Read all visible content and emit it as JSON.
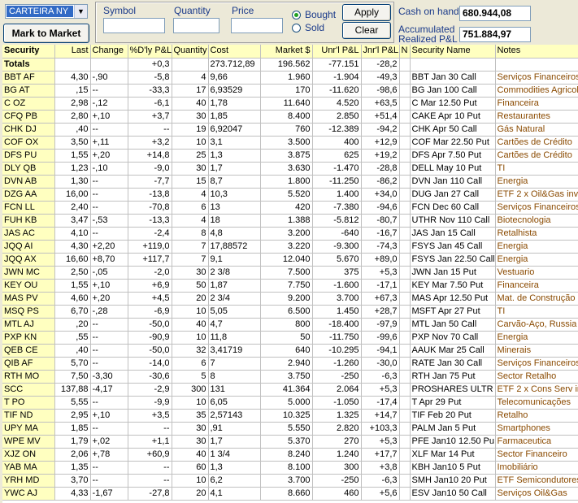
{
  "toolbar": {
    "account": "CARTEIRA NY",
    "mark_to_market": "Mark to Market",
    "symbol_label": "Symbol",
    "quantity_label": "Quantity",
    "price_label": "Price",
    "symbol_value": "",
    "quantity_value": "",
    "price_value": "",
    "bought_label": "Bought",
    "sold_label": "Sold",
    "selected_side": "Bought",
    "apply": "Apply",
    "clear": "Clear",
    "cash_label": "Cash on hand",
    "cash_value": "680.944,08",
    "realized_label_1": "Accumulated",
    "realized_label_2": "Realized P&L",
    "realized_value": "751.884,97"
  },
  "columns": [
    "Security",
    "Last",
    "Change",
    "%D'ly P&L",
    "Quantity",
    "Cost",
    "Market $",
    "Unr'l P&L",
    "Jnr'l P&L",
    "N",
    "Security Name",
    "Notes"
  ],
  "totals": [
    "Totals",
    "",
    "",
    "+0,3",
    "",
    "273.712,89",
    "196.562",
    "-77.151",
    "-28,2",
    "",
    "",
    ""
  ],
  "rows": [
    [
      "BBT AF",
      "4,30",
      "-,90",
      "-5,8",
      "4",
      "9,66",
      "1.960",
      "-1.904",
      "-49,3",
      "",
      "BBT Jan 30 Call",
      "Serviços Financeiros"
    ],
    [
      "BG AT",
      ",15",
      "--",
      "-33,3",
      "17",
      "6,93529",
      "170",
      "-11.620",
      "-98,6",
      "",
      "BG Jan 100 Call",
      "Commodities Agricolas"
    ],
    [
      "C OZ",
      "2,98",
      "-,12",
      "-6,1",
      "40",
      "1,78",
      "11.640",
      "4.520",
      "+63,5",
      "",
      "C Mar 12.50 Put",
      "Financeira"
    ],
    [
      "CFQ PB",
      "2,80",
      "+,10",
      "+3,7",
      "30",
      "1,85",
      "8.400",
      "2.850",
      "+51,4",
      "",
      "CAKE Apr 10 Put",
      "Restaurantes"
    ],
    [
      "CHK DJ",
      ",40",
      "--",
      "--",
      "19",
      "6,92047",
      "760",
      "-12.389",
      "-94,2",
      "",
      "CHK Apr 50 Call",
      "Gás Natural"
    ],
    [
      "COF OX",
      "3,50",
      "+,11",
      "+3,2",
      "10",
      "3,1",
      "3.500",
      "400",
      "+12,9",
      "",
      "COF Mar 22.50 Put",
      "Cartões de Crédito"
    ],
    [
      "DFS PU",
      "1,55",
      "+,20",
      "+14,8",
      "25",
      "1,3",
      "3.875",
      "625",
      "+19,2",
      "",
      "DFS Apr 7.50 Put",
      "Cartões de Crédito"
    ],
    [
      "DLY QB",
      "1,23",
      "-,10",
      "-9,0",
      "30",
      "1,7",
      "3.630",
      "-1.470",
      "-28,8",
      "",
      "DELL May 10 Put",
      "TI"
    ],
    [
      "DVN AB",
      "1,30",
      "--",
      "-7,7",
      "15",
      "8,7",
      "1.800",
      "-11.250",
      "-86,2",
      "",
      "DVN Jan 110 Call",
      "Energia"
    ],
    [
      "DZG AA",
      "16,00",
      "--",
      "-13,8",
      "4",
      "10,3",
      "5.520",
      "1.400",
      "+34,0",
      "",
      "DUG Jan 27 Call",
      "ETF 2 x Oil&Gas inv"
    ],
    [
      "FCN LL",
      "2,40",
      "--",
      "-70,8",
      "6",
      "13",
      "420",
      "-7.380",
      "-94,6",
      "",
      "FCN Dec 60 Call",
      "Serviços Financeiros"
    ],
    [
      "FUH KB",
      "3,47",
      "-,53",
      "-13,3",
      "4",
      "18",
      "1.388",
      "-5.812",
      "-80,7",
      "",
      "UTHR Nov 110 Call",
      "Biotecnologia"
    ],
    [
      "JAS AC",
      "4,10",
      "--",
      "-2,4",
      "8",
      "4,8",
      "3.200",
      "-640",
      "-16,7",
      "",
      "JAS Jan 15 Call",
      "Retalhista"
    ],
    [
      "JQQ AI",
      "4,30",
      "+2,20",
      "+119,0",
      "7",
      "17,88572",
      "3.220",
      "-9.300",
      "-74,3",
      "",
      "FSYS Jan 45 Call",
      "Energia"
    ],
    [
      "JQQ AX",
      "16,60",
      "+8,70",
      "+117,7",
      "7",
      "9,1",
      "12.040",
      "5.670",
      "+89,0",
      "",
      "FSYS Jan 22.50 Call",
      "Energia"
    ],
    [
      "JWN MC",
      "2,50",
      "-,05",
      "-2,0",
      "30",
      "2  3/8",
      "7.500",
      "375",
      "+5,3",
      "",
      "JWN Jan 15 Put",
      "Vestuario"
    ],
    [
      "KEY OU",
      "1,55",
      "+,10",
      "+6,9",
      "50",
      "1,87",
      "7.750",
      "-1.600",
      "-17,1",
      "",
      "KEY Mar 7.50 Put",
      "Financeira"
    ],
    [
      "MAS PV",
      "4,60",
      "+,20",
      "+4,5",
      "20",
      "2  3/4",
      "9.200",
      "3.700",
      "+67,3",
      "",
      "MAS Apr 12.50 Put",
      "Mat. de Construção"
    ],
    [
      "MSQ PS",
      "6,70",
      "-,28",
      "-6,9",
      "10",
      "5,05",
      "6.500",
      "1.450",
      "+28,7",
      "",
      "MSFT Apr 27 Put",
      "TI"
    ],
    [
      "MTL AJ",
      ",20",
      "--",
      "-50,0",
      "40",
      "4,7",
      "800",
      "-18.400",
      "-97,9",
      "",
      "MTL Jan 50 Call",
      "Carvão-Aço, Russia"
    ],
    [
      "PXP KN",
      ",55",
      "--",
      "-90,9",
      "10",
      "11,8",
      "50",
      "-11.750",
      "-99,6",
      "",
      "PXP Nov 70 Call",
      "Energia"
    ],
    [
      "QEB CE",
      ",40",
      "--",
      "-50,0",
      "32",
      "3,41719",
      "640",
      "-10.295",
      "-94,1",
      "",
      "AAUK Mar 25 Call",
      "Minerais"
    ],
    [
      "QIB AF",
      "5,70",
      "--",
      "-14,0",
      "6",
      "7",
      "2.940",
      "-1.260",
      "-30,0",
      "",
      "RATE Jan 30 Call",
      "Serviços Financeiros"
    ],
    [
      "RTH MO",
      "7,50",
      "-3,30",
      "-30,6",
      "5",
      "8",
      "3.750",
      "-250",
      "-6,3",
      "",
      "RTH Jan 75 Put",
      "Sector Retalho"
    ],
    [
      "SCC",
      "137,88",
      "-4,17",
      "-2,9",
      "300",
      "131",
      "41.364",
      "2.064",
      "+5,3",
      "",
      "PROSHARES ULTR",
      "ETF 2 x Cons Serv inv"
    ],
    [
      "T PO",
      "5,55",
      "--",
      "-9,9",
      "10",
      "6,05",
      "5.000",
      "-1.050",
      "-17,4",
      "",
      "T Apr 29 Put",
      "Telecomunicações"
    ],
    [
      "TIF ND",
      "2,95",
      "+,10",
      "+3,5",
      "35",
      "2,57143",
      "10.325",
      "1.325",
      "+14,7",
      "",
      "TIF Feb 20 Put",
      "Retalho"
    ],
    [
      "UPY MA",
      "1,85",
      "--",
      "--",
      "30",
      ",91",
      "5.550",
      "2.820",
      "+103,3",
      "",
      "PALM Jan 5 Put",
      "Smartphones"
    ],
    [
      "WPE MV",
      "1,79",
      "+,02",
      "+1,1",
      "30",
      "1,7",
      "5.370",
      "270",
      "+5,3",
      "",
      "PFE Jan10 12.50 Pu",
      "Farmaceutica"
    ],
    [
      "XJZ ON",
      "2,06",
      "+,78",
      "+60,9",
      "40",
      "1  3/4",
      "8.240",
      "1.240",
      "+17,7",
      "",
      "XLF Mar 14 Put",
      "Sector Financeiro"
    ],
    [
      "YAB MA",
      "1,35",
      "--",
      "--",
      "60",
      "1,3",
      "8.100",
      "300",
      "+3,8",
      "",
      "KBH Jan10 5 Put",
      "Imobiliário"
    ],
    [
      "YRH MD",
      "3,70",
      "--",
      "--",
      "10",
      "6,2",
      "3.700",
      "-250",
      "-6,3",
      "",
      "SMH Jan10 20 Put",
      "ETF Semicondutores"
    ],
    [
      "YWC AJ",
      "4,33",
      "-1,67",
      "-27,8",
      "20",
      "4,1",
      "8.660",
      "460",
      "+5,6",
      "",
      "ESV Jan10 50 Call",
      "Serviços Oil&Gas"
    ]
  ]
}
